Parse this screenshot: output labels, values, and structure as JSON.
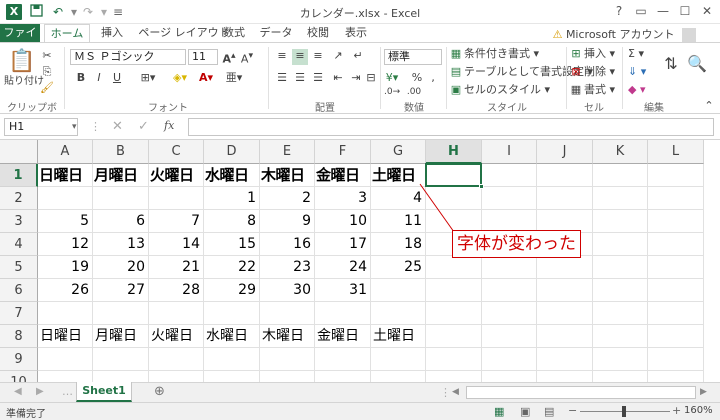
{
  "window": {
    "title": "カレンダー.xlsx - Excel",
    "app_icon": "X",
    "controls": [
      "?",
      "▭",
      "—",
      "☐",
      "✕"
    ]
  },
  "quick_access": [
    "save-icon",
    "undo-icon",
    "redo-icon",
    "customize-icon"
  ],
  "tabs": [
    {
      "label": "ファイル"
    },
    {
      "label": "ホーム"
    },
    {
      "label": "挿入"
    },
    {
      "label": "ページ レイアウト"
    },
    {
      "label": "数式"
    },
    {
      "label": "データ"
    },
    {
      "label": "校閲"
    },
    {
      "label": "表示"
    }
  ],
  "account": "Microsoft アカウント",
  "ribbon": {
    "clipboard": {
      "label": "クリップボード",
      "paste": "貼り付け"
    },
    "font": {
      "label": "フォント",
      "name": "ＭＳ Ｐゴシック",
      "size": "11",
      "bold": "B",
      "italic": "I",
      "underline": "U"
    },
    "alignment": {
      "label": "配置"
    },
    "number": {
      "label": "数値",
      "format": "標準",
      "percent": "%",
      "comma": "‚"
    },
    "styles": {
      "label": "スタイル",
      "items": [
        "条件付き書式 ▾",
        "テーブルとして書式設定 ▾",
        "セルのスタイル ▾"
      ]
    },
    "cells": {
      "label": "セル",
      "items": [
        "挿入 ▾",
        "削除 ▾",
        "書式 ▾"
      ]
    },
    "editing": {
      "label": "編集",
      "items": [
        "Σ ▾",
        "⇓ ▾",
        "◆ ▾"
      ]
    }
  },
  "formula_bar": {
    "name_box": "H1",
    "fx": "fx",
    "value": ""
  },
  "columns": [
    "A",
    "B",
    "C",
    "D",
    "E",
    "F",
    "G",
    "H",
    "I",
    "J",
    "K",
    "L"
  ],
  "rows": [
    "1",
    "2",
    "3",
    "4",
    "5",
    "6",
    "7",
    "8",
    "9",
    "10"
  ],
  "cells": {
    "r1": [
      "日曜日",
      "月曜日",
      "火曜日",
      "水曜日",
      "木曜日",
      "金曜日",
      "土曜日"
    ],
    "r2": [
      "",
      "",
      "",
      "1",
      "2",
      "3",
      "4"
    ],
    "r3": [
      "5",
      "6",
      "7",
      "8",
      "9",
      "10",
      "11"
    ],
    "r4": [
      "12",
      "13",
      "14",
      "15",
      "16",
      "17",
      "18"
    ],
    "r5": [
      "19",
      "20",
      "21",
      "22",
      "23",
      "24",
      "25"
    ],
    "r6": [
      "26",
      "27",
      "28",
      "29",
      "30",
      "31",
      ""
    ],
    "r8": [
      "日曜日",
      "月曜日",
      "火曜日",
      "水曜日",
      "木曜日",
      "金曜日",
      "土曜日"
    ]
  },
  "annotation": "字体が変わった",
  "sheet_tab": "Sheet1",
  "status": {
    "text": "準備完了",
    "zoom": "160%"
  },
  "colors": {
    "excel_green": "#217346",
    "callout_red": "#d00000"
  }
}
